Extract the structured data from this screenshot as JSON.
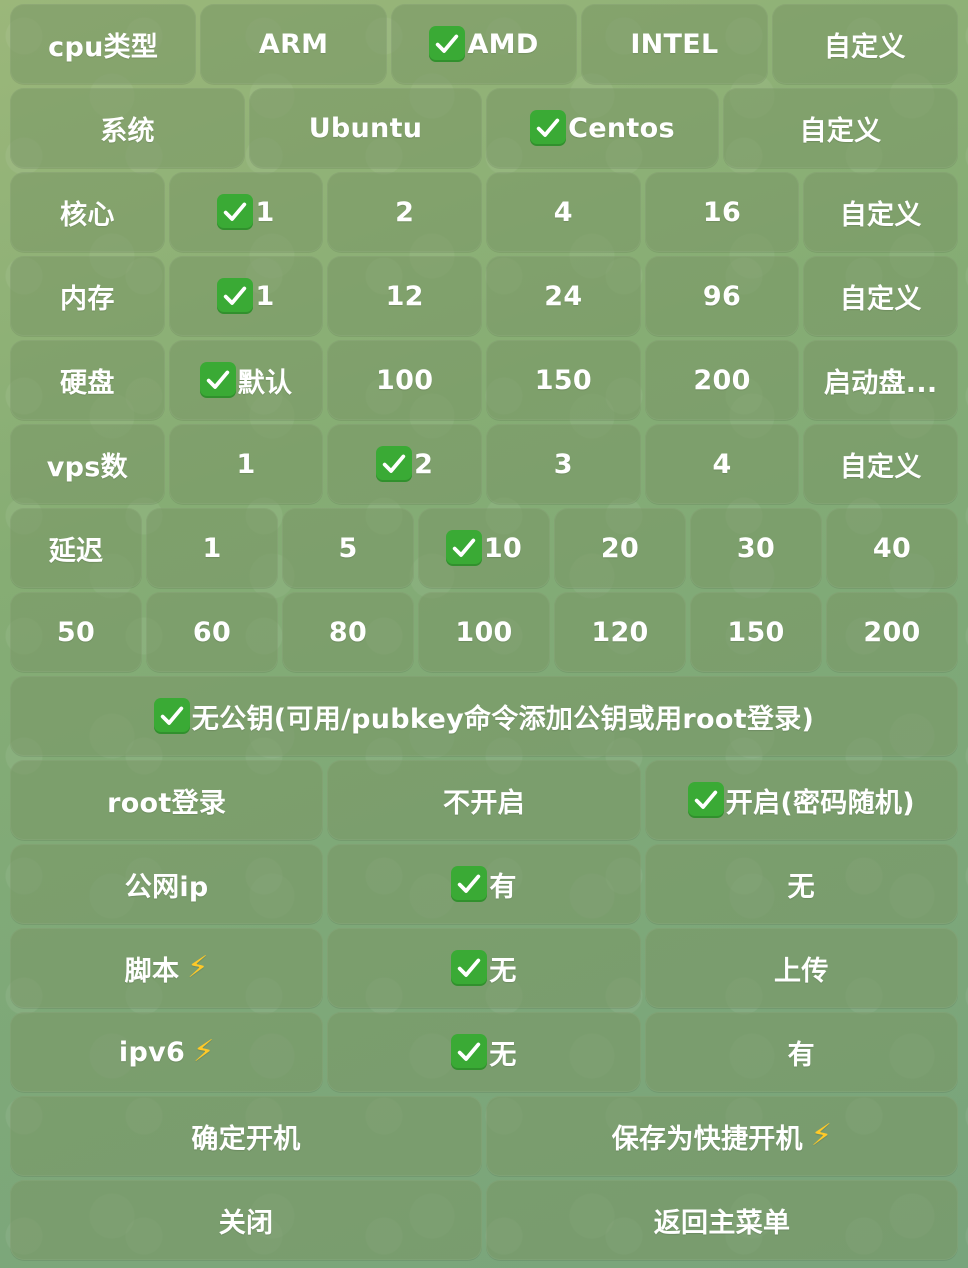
{
  "keyboard": {
    "rows": [
      [
        {
          "id": "cpu-label",
          "text": "cpu类型",
          "checked": false
        },
        {
          "id": "cpu-arm",
          "text": "ARM",
          "checked": false
        },
        {
          "id": "cpu-amd",
          "text": "AMD",
          "checked": true
        },
        {
          "id": "cpu-intel",
          "text": "INTEL",
          "checked": false
        },
        {
          "id": "cpu-custom",
          "text": "自定义",
          "checked": false
        }
      ],
      [
        {
          "id": "os-label",
          "text": "系统",
          "checked": false
        },
        {
          "id": "os-ubuntu",
          "text": "Ubuntu",
          "checked": false
        },
        {
          "id": "os-centos",
          "text": "Centos",
          "checked": true
        },
        {
          "id": "os-custom",
          "text": "自定义",
          "checked": false
        }
      ],
      [
        {
          "id": "core-label",
          "text": "核心",
          "checked": false
        },
        {
          "id": "core-1",
          "text": "1",
          "checked": true
        },
        {
          "id": "core-2",
          "text": "2",
          "checked": false
        },
        {
          "id": "core-4",
          "text": "4",
          "checked": false
        },
        {
          "id": "core-16",
          "text": "16",
          "checked": false
        },
        {
          "id": "core-custom",
          "text": "自定义",
          "checked": false
        }
      ],
      [
        {
          "id": "mem-label",
          "text": "内存",
          "checked": false
        },
        {
          "id": "mem-1",
          "text": "1",
          "checked": true
        },
        {
          "id": "mem-12",
          "text": "12",
          "checked": false
        },
        {
          "id": "mem-24",
          "text": "24",
          "checked": false
        },
        {
          "id": "mem-96",
          "text": "96",
          "checked": false
        },
        {
          "id": "mem-custom",
          "text": "自定义",
          "checked": false
        }
      ],
      [
        {
          "id": "disk-label",
          "text": "硬盘",
          "checked": false
        },
        {
          "id": "disk-default",
          "text": "默认",
          "checked": true
        },
        {
          "id": "disk-100",
          "text": "100",
          "checked": false
        },
        {
          "id": "disk-150",
          "text": "150",
          "checked": false
        },
        {
          "id": "disk-200",
          "text": "200",
          "checked": false
        },
        {
          "id": "disk-boot",
          "text": "启动盘...",
          "checked": false
        }
      ],
      [
        {
          "id": "vps-label",
          "text": "vps数",
          "checked": false
        },
        {
          "id": "vps-1",
          "text": "1",
          "checked": false
        },
        {
          "id": "vps-2",
          "text": "2",
          "checked": true
        },
        {
          "id": "vps-3",
          "text": "3",
          "checked": false
        },
        {
          "id": "vps-4",
          "text": "4",
          "checked": false
        },
        {
          "id": "vps-custom",
          "text": "自定义",
          "checked": false
        }
      ],
      [
        {
          "id": "delay-label",
          "text": "延迟",
          "checked": false
        },
        {
          "id": "delay-1",
          "text": "1",
          "checked": false
        },
        {
          "id": "delay-5",
          "text": "5",
          "checked": false
        },
        {
          "id": "delay-10",
          "text": "10",
          "checked": true
        },
        {
          "id": "delay-20",
          "text": "20",
          "checked": false
        },
        {
          "id": "delay-30",
          "text": "30",
          "checked": false
        },
        {
          "id": "delay-40",
          "text": "40",
          "checked": false
        }
      ],
      [
        {
          "id": "delay-50",
          "text": "50",
          "checked": false
        },
        {
          "id": "delay-60",
          "text": "60",
          "checked": false
        },
        {
          "id": "delay-80",
          "text": "80",
          "checked": false
        },
        {
          "id": "delay-100",
          "text": "100",
          "checked": false
        },
        {
          "id": "delay-120",
          "text": "120",
          "checked": false
        },
        {
          "id": "delay-150",
          "text": "150",
          "checked": false
        },
        {
          "id": "delay-200",
          "text": "200",
          "checked": false
        }
      ],
      [
        {
          "id": "pubkey",
          "text": "无公钥(可用/pubkey命令添加公钥或用root登录)",
          "checked": true
        }
      ],
      [
        {
          "id": "root-label",
          "text": "root登录",
          "checked": false
        },
        {
          "id": "root-off",
          "text": "不开启",
          "checked": false
        },
        {
          "id": "root-on",
          "text": "开启(密码随机)",
          "checked": true
        }
      ],
      [
        {
          "id": "ip-label",
          "text": "公网ip",
          "checked": false
        },
        {
          "id": "ip-yes",
          "text": "有",
          "checked": true
        },
        {
          "id": "ip-no",
          "text": "无",
          "checked": false
        }
      ],
      [
        {
          "id": "script-label",
          "text": "脚本",
          "checked": false,
          "bolt": true
        },
        {
          "id": "script-none",
          "text": "无",
          "checked": true
        },
        {
          "id": "script-upload",
          "text": "上传",
          "checked": false
        }
      ],
      [
        {
          "id": "ipv6-label",
          "text": "ipv6",
          "checked": false,
          "bolt": true
        },
        {
          "id": "ipv6-no",
          "text": "无",
          "checked": true
        },
        {
          "id": "ipv6-yes",
          "text": "有",
          "checked": false
        }
      ],
      [
        {
          "id": "confirm",
          "text": "确定开机",
          "checked": false
        },
        {
          "id": "save-quick",
          "text": "保存为快捷开机",
          "checked": false,
          "bolt": true
        }
      ],
      [
        {
          "id": "close",
          "text": "关闭",
          "checked": false
        },
        {
          "id": "back-main",
          "text": "返回主菜单",
          "checked": false
        }
      ]
    ],
    "icons": {
      "check": "check-mark-icon",
      "bolt": "lightning-bolt-icon"
    },
    "colors": {
      "check_bg": "#3aaa35",
      "bolt": "#ffc928",
      "button_bg": "rgba(120,150,100,0.55)"
    }
  }
}
